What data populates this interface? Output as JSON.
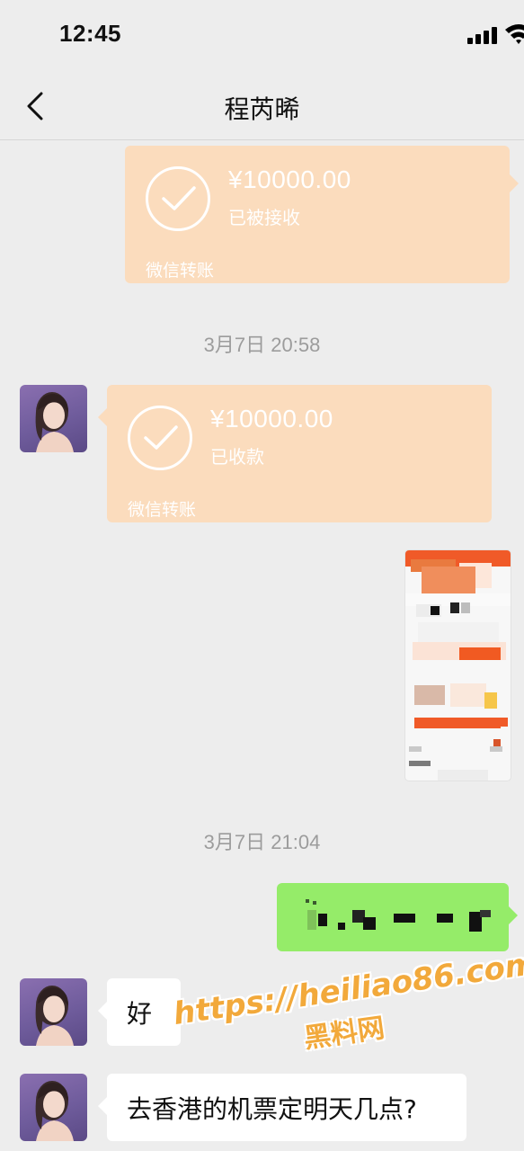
{
  "status_bar": {
    "time": "12:45"
  },
  "nav": {
    "title": "程芮晞"
  },
  "messages": {
    "transfer_sent": {
      "amount": "¥10000.00",
      "status": "已被接收",
      "label": "微信转账"
    },
    "timestamp_1": "3月7日 20:58",
    "transfer_received": {
      "amount": "¥10000.00",
      "status": "已收款",
      "label": "微信转账"
    },
    "timestamp_2": "3月7日 21:04",
    "reply_1": "好",
    "reply_2": "去香港的机票定明天几点?"
  },
  "watermark": {
    "url": "https://heiliao86.com",
    "name": "黑料网"
  },
  "colors": {
    "background": "#ededed",
    "transfer_bubble": "#fbdcbd",
    "sent_bubble": "#95ec69",
    "received_bubble": "#ffffff",
    "timestamp": "#9c9c9c",
    "watermark": "#f2a93b"
  },
  "icons": [
    "signal-icon",
    "wifi-icon",
    "back-chevron-icon",
    "check-circle-icon",
    "avatar"
  ]
}
